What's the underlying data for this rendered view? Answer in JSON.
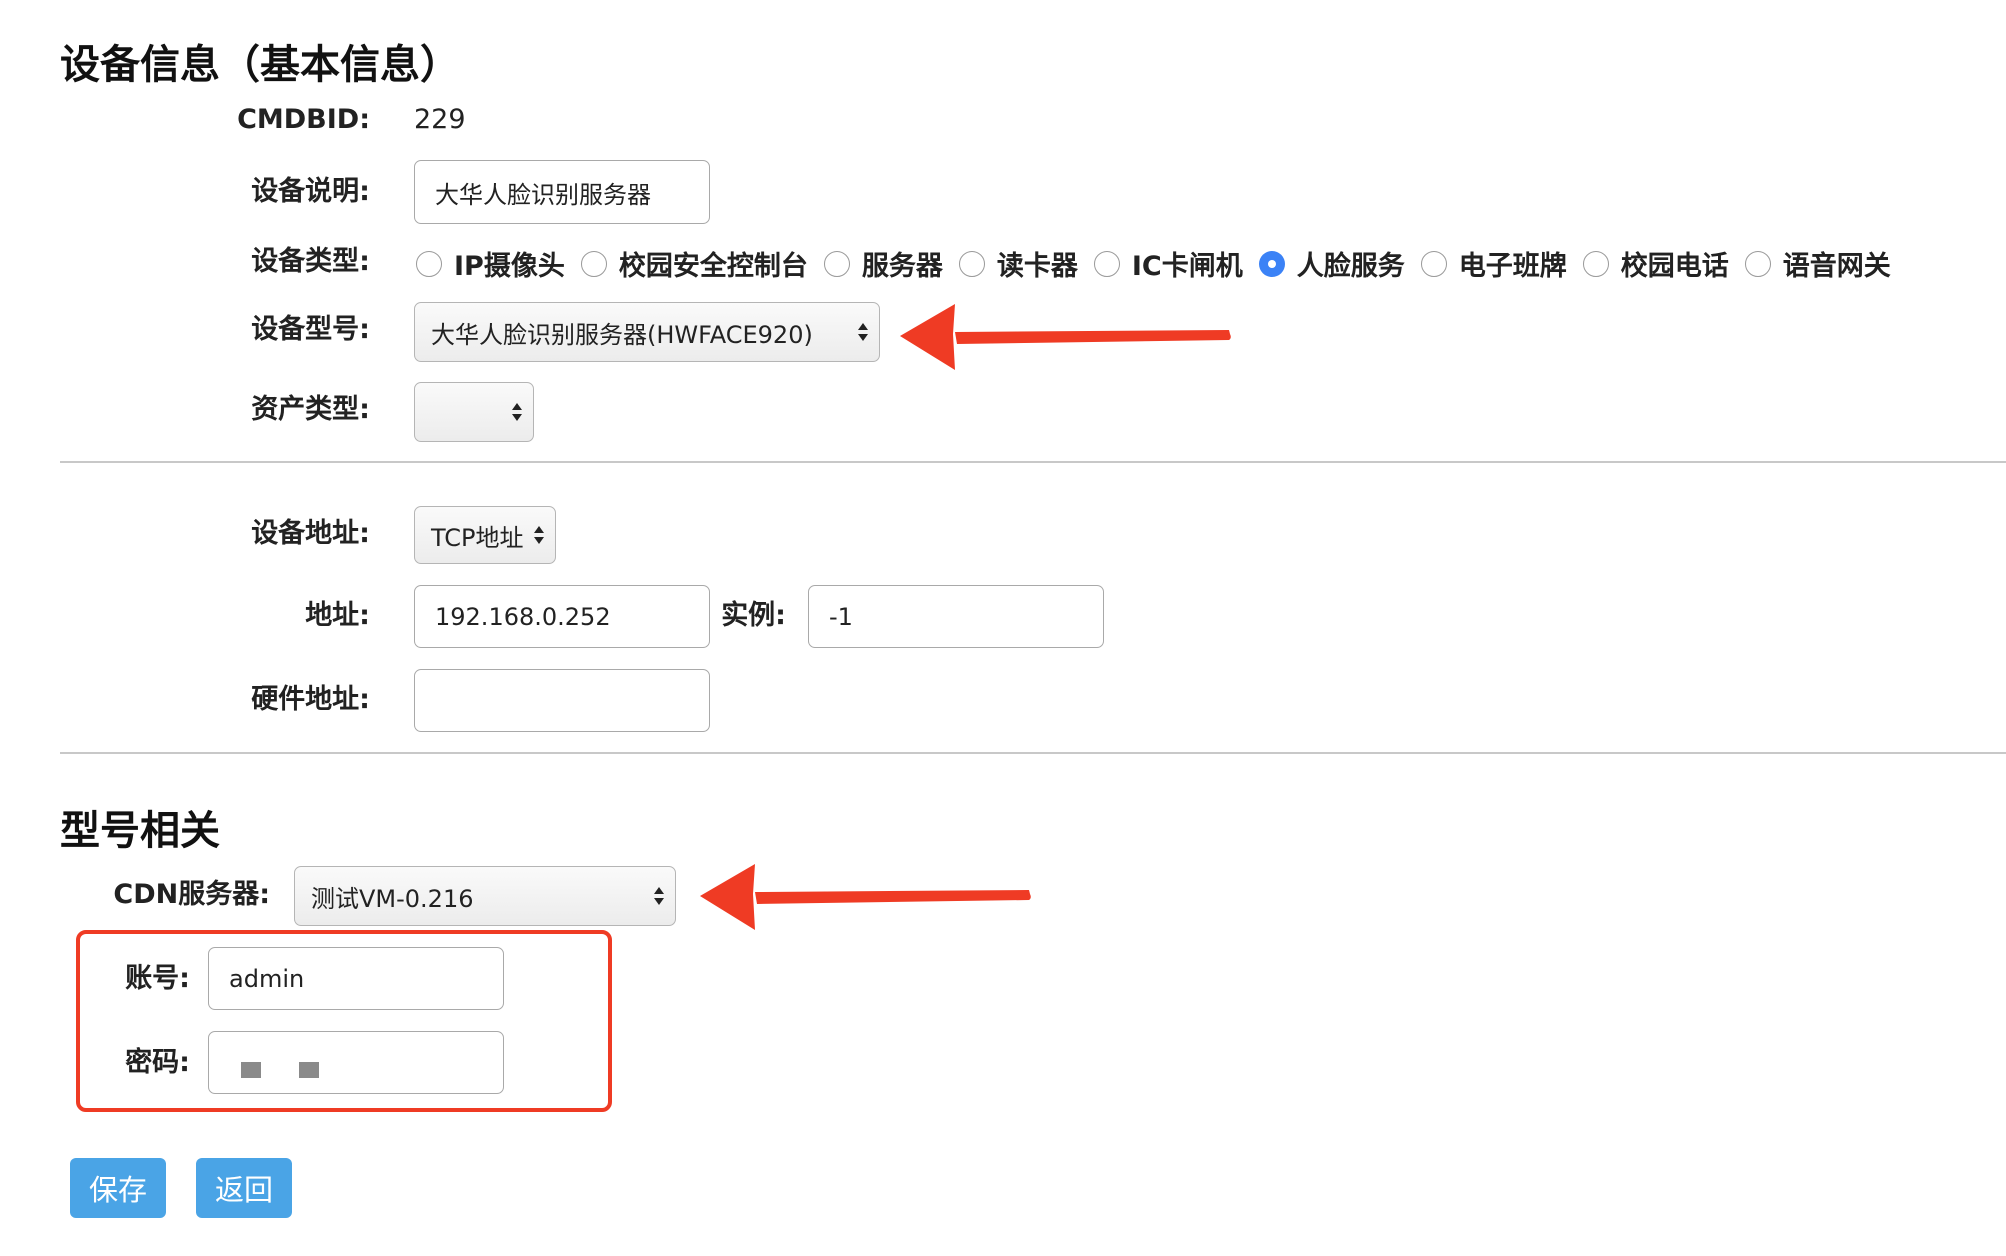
{
  "sections": {
    "basic_title": "设备信息（基本信息）",
    "model_title": "型号相关"
  },
  "fields": {
    "cmdbid": {
      "label": "CMDBID:",
      "value": "229"
    },
    "description": {
      "label": "设备说明:",
      "value": "大华人脸识别服务器"
    },
    "device_type": {
      "label": "设备类型:",
      "options": [
        "IP摄像头",
        "校园安全控制台",
        "服务器",
        "读卡器",
        "IC卡闸机",
        "人脸服务",
        "电子班牌",
        "校园电话",
        "语音网关"
      ],
      "selected": "人脸服务"
    },
    "device_model": {
      "label": "设备型号:",
      "value": "大华人脸识别服务器(HWFACE920)"
    },
    "asset_type": {
      "label": "资产类型:",
      "value": ""
    },
    "device_address": {
      "label": "设备地址:",
      "value": "TCP地址"
    },
    "address": {
      "label": "地址:",
      "value": "192.168.0.252"
    },
    "instance": {
      "label": "实例:",
      "value": "-1"
    },
    "hardware_address": {
      "label": "硬件地址:",
      "value": ""
    },
    "cdn_server": {
      "label": "CDN服务器:",
      "value": "测试VM-0.216"
    },
    "account": {
      "label": "账号:",
      "value": "admin"
    },
    "password": {
      "label": "密码:"
    }
  },
  "buttons": {
    "save": "保存",
    "back": "返回"
  },
  "colors": {
    "primary_button": "#4aa4e6",
    "radio_checked": "#3b82f6",
    "annotation_red": "#ef3b24"
  }
}
